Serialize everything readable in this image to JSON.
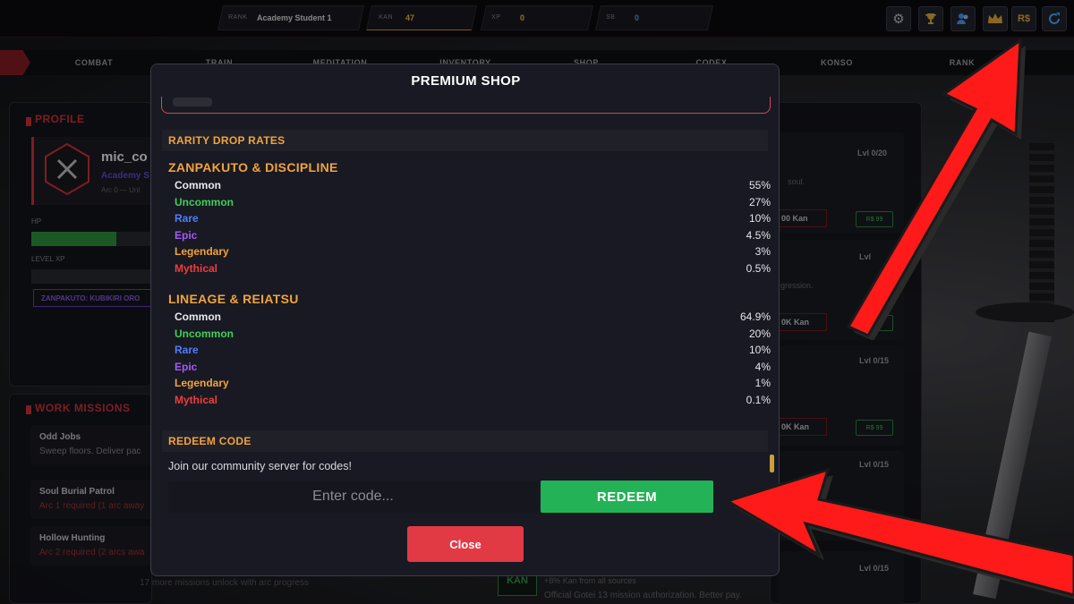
{
  "topbar": {
    "rank": {
      "label": "RANK",
      "value": "Academy Student 1"
    },
    "kan": {
      "label": "KAN",
      "value": "47"
    },
    "xp": {
      "label": "XP",
      "value": "0"
    },
    "sb": {
      "label": "SB",
      "value": "0"
    },
    "icons": [
      "gear-icon",
      "trophy-icon",
      "users-icon",
      "crown-icon",
      "rs-icon",
      "refresh-icon"
    ],
    "rs_label": "R$"
  },
  "nav": {
    "tabs": [
      "COMBAT",
      "TRAIN",
      "MEDITATION",
      "INVENTORY",
      "SHOP",
      "CODEX",
      "KONSO",
      "RANK"
    ]
  },
  "profile": {
    "header": "PROFILE",
    "name": "mic_co",
    "rank": "Academy S",
    "arc": "Arc 0 — Unl",
    "hp_label": "HP",
    "hp_fill": 0.7,
    "xp_label": "LEVEL XP",
    "zanpakuto": "ZANPAKUTO: KUBIKIRI ORO"
  },
  "work_missions": {
    "header": "WORK MISSIONS",
    "items": [
      {
        "title": "Odd Jobs",
        "sub": "Sweep floors. Deliver pac"
      },
      {
        "title": "Soul Burial Patrol",
        "sub": "Arc 1 required (1 arc away"
      },
      {
        "title": "Hollow Hunting",
        "sub": "Arc 2 required (2 arcs awa"
      }
    ],
    "footer": "17 more missions unlock with arc progress"
  },
  "upgrades": {
    "cards": [
      {
        "lvl": "Lvl 0/20",
        "desc": "soul.",
        "kan": "00 Kan",
        "rs": "R$ 99"
      },
      {
        "lvl": "Lvl",
        "desc": "gression.",
        "kan": "0K Kan",
        "rs": "R$"
      },
      {
        "lvl": "Lvl 0/15",
        "desc": "",
        "kan": "0K Kan",
        "rs": "R$ 99"
      },
      {
        "lvl": "Lvl 0/15",
        "desc": "",
        "kan": "",
        "rs": ""
      },
      {
        "lvl": "Lvl 0/15",
        "desc": "+8% Kan from all sources",
        "desc2": "Official Gotei 13 mission authorization. Better pay.",
        "kan": "KAN",
        "rs": ""
      }
    ]
  },
  "modal": {
    "title": "PREMIUM SHOP",
    "drop_rates_header": "RARITY DROP RATES",
    "groups": [
      {
        "title": "ZANPAKUTO & DISCIPLINE",
        "rates": [
          {
            "name": "Common",
            "value": "55%",
            "color": "#e8e8ee"
          },
          {
            "name": "Uncommon",
            "value": "27%",
            "color": "#3fcf58"
          },
          {
            "name": "Rare",
            "value": "10%",
            "color": "#4f7dff"
          },
          {
            "name": "Epic",
            "value": "4.5%",
            "color": "#a45bf2"
          },
          {
            "name": "Legendary",
            "value": "3%",
            "color": "#f2a33c"
          },
          {
            "name": "Mythical",
            "value": "0.5%",
            "color": "#ef3d3d"
          }
        ]
      },
      {
        "title": "LINEAGE & REIATSU",
        "rates": [
          {
            "name": "Common",
            "value": "64.9%",
            "color": "#e8e8ee"
          },
          {
            "name": "Uncommon",
            "value": "20%",
            "color": "#3fcf58"
          },
          {
            "name": "Rare",
            "value": "10%",
            "color": "#4f7dff"
          },
          {
            "name": "Epic",
            "value": "4%",
            "color": "#a45bf2"
          },
          {
            "name": "Legendary",
            "value": "1%",
            "color": "#f2a33c"
          },
          {
            "name": "Mythical",
            "value": "0.1%",
            "color": "#ef3d3d"
          }
        ]
      }
    ],
    "redeem_header": "REDEEM CODE",
    "community_text": "Join our community server for codes!",
    "code_placeholder": "Enter code...",
    "redeem_label": "REDEEM",
    "close_label": "Close"
  },
  "colors": {
    "accent_red": "#d8333b",
    "gold": "#f2a33c",
    "redeem_green": "#23b356",
    "close_red": "#e23a45",
    "arrow_red": "#ff1a1a"
  }
}
